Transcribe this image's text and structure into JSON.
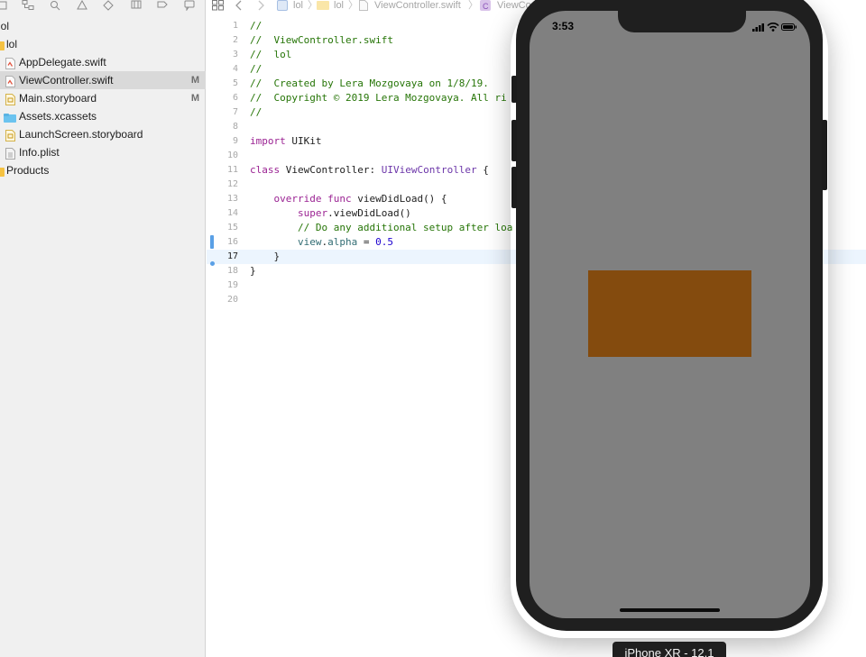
{
  "navigator": {
    "items": [
      {
        "label": "lol",
        "badge": "",
        "icon": "folder-icon"
      },
      {
        "label": "lol",
        "badge": "",
        "icon": "folder-icon"
      },
      {
        "label": "AppDelegate.swift",
        "badge": "",
        "icon": "swift-file-icon"
      },
      {
        "label": "ViewController.swift",
        "badge": "M",
        "icon": "swift-file-icon"
      },
      {
        "label": "Main.storyboard",
        "badge": "M",
        "icon": "storyboard-file-icon"
      },
      {
        "label": "Assets.xcassets",
        "badge": "",
        "icon": "assets-folder-icon"
      },
      {
        "label": "LaunchScreen.storyboard",
        "badge": "",
        "icon": "storyboard-file-icon"
      },
      {
        "label": "Info.plist",
        "badge": "",
        "icon": "plist-file-icon"
      },
      {
        "label": "Products",
        "badge": "",
        "icon": "folder-icon"
      }
    ]
  },
  "jump_bar": {
    "project": "lol",
    "group": "lol",
    "file": "ViewController.swift",
    "symbol": "ViewCo"
  },
  "editor": {
    "current_line": "17",
    "lines": [
      {
        "n": "1",
        "tokens": [
          {
            "t": "//",
            "c": "comment"
          }
        ]
      },
      {
        "n": "2",
        "tokens": [
          {
            "t": "//  ViewController.swift",
            "c": "comment"
          }
        ]
      },
      {
        "n": "3",
        "tokens": [
          {
            "t": "//  lol",
            "c": "comment"
          }
        ]
      },
      {
        "n": "4",
        "tokens": [
          {
            "t": "//",
            "c": "comment"
          }
        ]
      },
      {
        "n": "5",
        "tokens": [
          {
            "t": "//  Created by Lera Mozgovaya on 1/8/19.",
            "c": "comment"
          }
        ]
      },
      {
        "n": "6",
        "tokens": [
          {
            "t": "//  Copyright © 2019 Lera Mozgovaya. All ri",
            "c": "comment"
          }
        ]
      },
      {
        "n": "7",
        "tokens": [
          {
            "t": "//",
            "c": "comment"
          }
        ]
      },
      {
        "n": "8",
        "tokens": []
      },
      {
        "n": "9",
        "tokens": [
          {
            "t": "import",
            "c": "kw"
          },
          {
            "t": " UIKit",
            "c": "plain"
          }
        ]
      },
      {
        "n": "10",
        "tokens": []
      },
      {
        "n": "11",
        "tokens": [
          {
            "t": "class",
            "c": "kw"
          },
          {
            "t": " ViewController: ",
            "c": "plain"
          },
          {
            "t": "UIViewController",
            "c": "type"
          },
          {
            "t": " {",
            "c": "plain"
          }
        ]
      },
      {
        "n": "12",
        "tokens": []
      },
      {
        "n": "13",
        "tokens": [
          {
            "t": "    override func",
            "c": "kw"
          },
          {
            "t": " viewDidLoad() {",
            "c": "plain"
          }
        ]
      },
      {
        "n": "14",
        "tokens": [
          {
            "t": "        super",
            "c": "kw"
          },
          {
            "t": ".viewDidLoad()",
            "c": "plain"
          }
        ]
      },
      {
        "n": "15",
        "tokens": [
          {
            "t": "        // Do any additional setup after loa",
            "c": "comment"
          }
        ]
      },
      {
        "n": "16",
        "tokens": [
          {
            "t": "        view",
            "c": "prop"
          },
          {
            "t": ".",
            "c": "plain"
          },
          {
            "t": "alpha",
            "c": "prop"
          },
          {
            "t": " = ",
            "c": "plain"
          },
          {
            "t": "0.5",
            "c": "num"
          }
        ]
      },
      {
        "n": "17",
        "tokens": [
          {
            "t": "    }",
            "c": "plain"
          }
        ]
      },
      {
        "n": "18",
        "tokens": [
          {
            "t": "}",
            "c": "plain"
          }
        ]
      },
      {
        "n": "19",
        "tokens": []
      },
      {
        "n": "20",
        "tokens": []
      }
    ]
  },
  "simulator": {
    "status_time": "3:53",
    "device_label": "iPhone XR - 12.1",
    "screen_color": "#808080",
    "view_color": "#844b0e"
  }
}
